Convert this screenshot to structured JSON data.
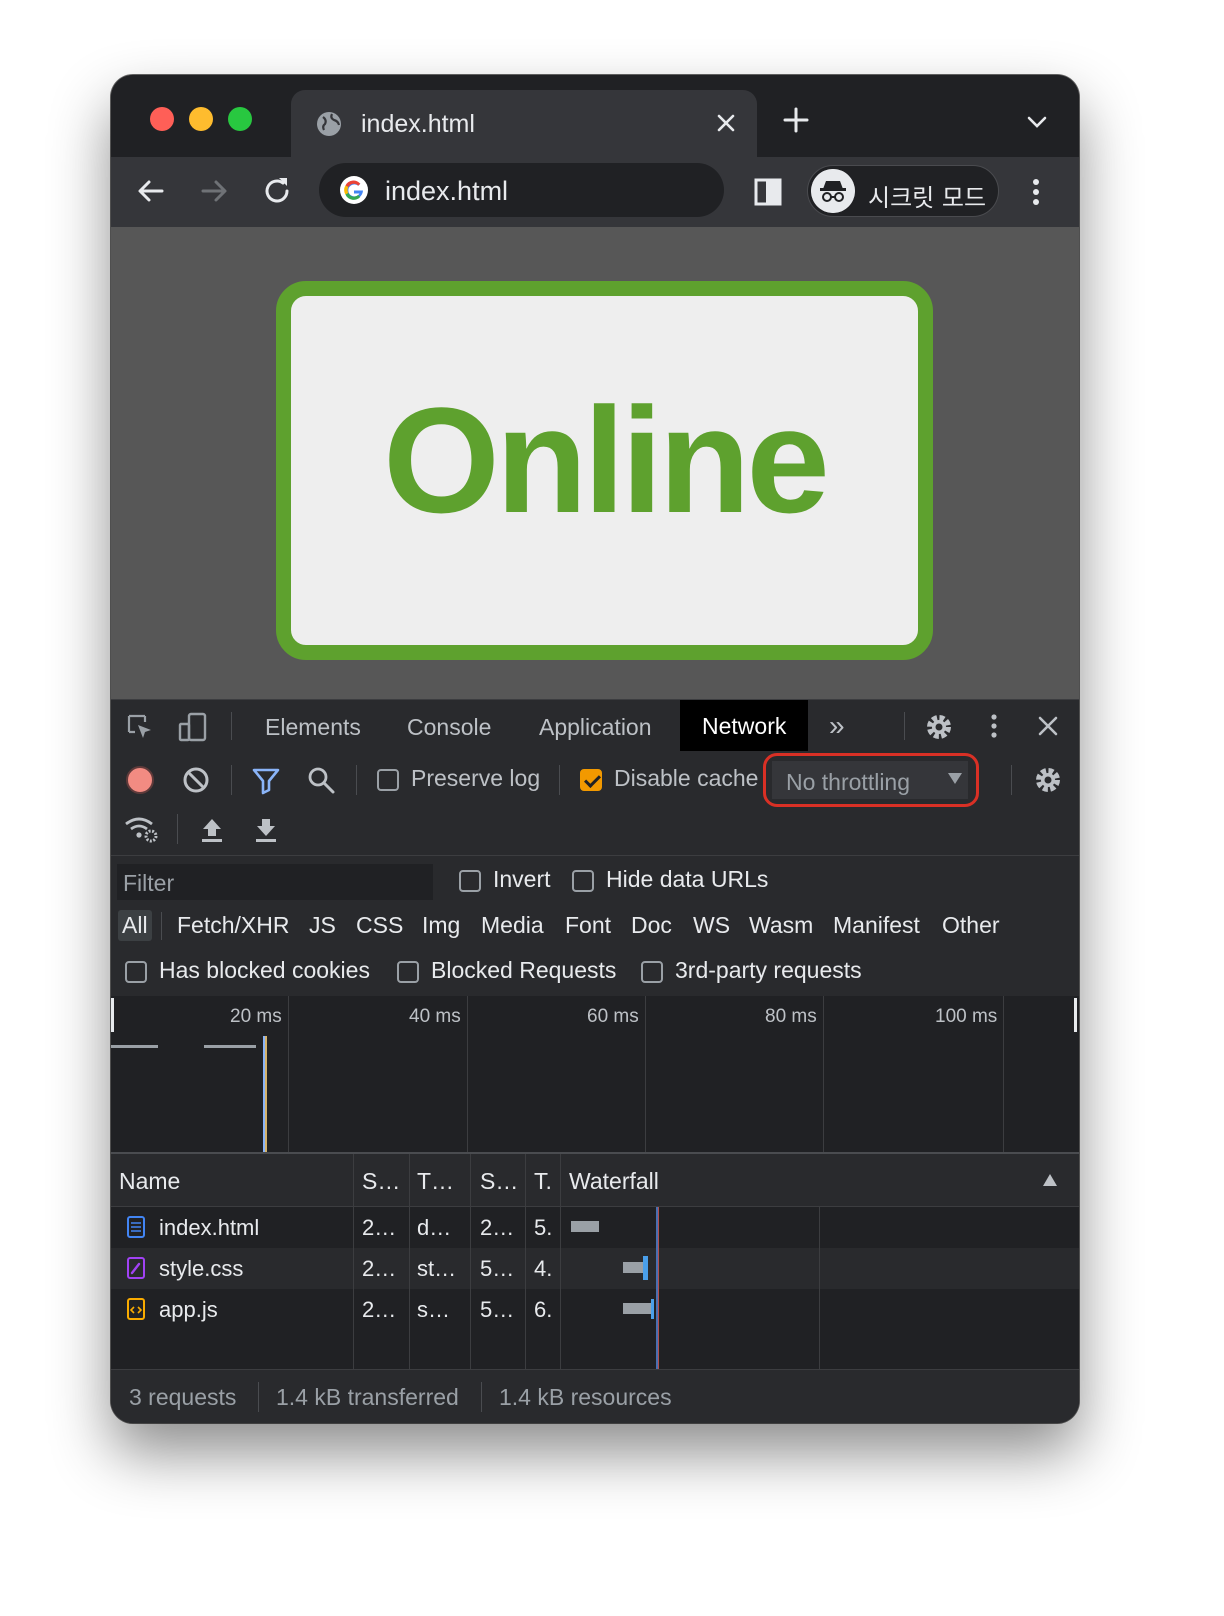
{
  "browser": {
    "tab_title": "index.html",
    "omnibox_url": "index.html",
    "profile_label": "시크릿 모드"
  },
  "page": {
    "status_text": "Online",
    "status_color": "#5ea12e"
  },
  "devtools": {
    "tabs": [
      "Elements",
      "Console",
      "Application",
      "Network"
    ],
    "active_tab": "Network",
    "more_tabs": "»",
    "toolbar": {
      "preserve_log": {
        "label": "Preserve log",
        "checked": false
      },
      "disable_cache": {
        "label": "Disable cache",
        "checked": true
      },
      "throttling": "No throttling"
    },
    "filter": {
      "placeholder": "Filter",
      "invert": "Invert",
      "hide_data_urls": "Hide data URLs",
      "types": [
        "All",
        "Fetch/XHR",
        "JS",
        "CSS",
        "Img",
        "Media",
        "Font",
        "Doc",
        "WS",
        "Wasm",
        "Manifest",
        "Other"
      ],
      "active_type": "All",
      "has_blocked_cookies": "Has blocked cookies",
      "blocked_requests": "Blocked Requests",
      "third_party": "3rd-party requests"
    },
    "overview_ticks": [
      "20 ms",
      "40 ms",
      "60 ms",
      "80 ms",
      "100 ms"
    ],
    "table": {
      "headers": [
        "Name",
        "S…",
        "T…",
        "S…",
        "T.",
        "Waterfall"
      ],
      "rows": [
        {
          "name": "index.html",
          "status": "2…",
          "type": "d…",
          "size": "2…",
          "time": "5.",
          "icon": "document-icon"
        },
        {
          "name": "style.css",
          "status": "2…",
          "type": "st…",
          "size": "5…",
          "time": "4.",
          "icon": "stylesheet-icon"
        },
        {
          "name": "app.js",
          "status": "2…",
          "type": "s…",
          "size": "5…",
          "time": "6.",
          "icon": "script-icon"
        }
      ]
    },
    "summary": {
      "requests": "3 requests",
      "transferred": "1.4 kB transferred",
      "resources": "1.4 kB resources"
    }
  }
}
